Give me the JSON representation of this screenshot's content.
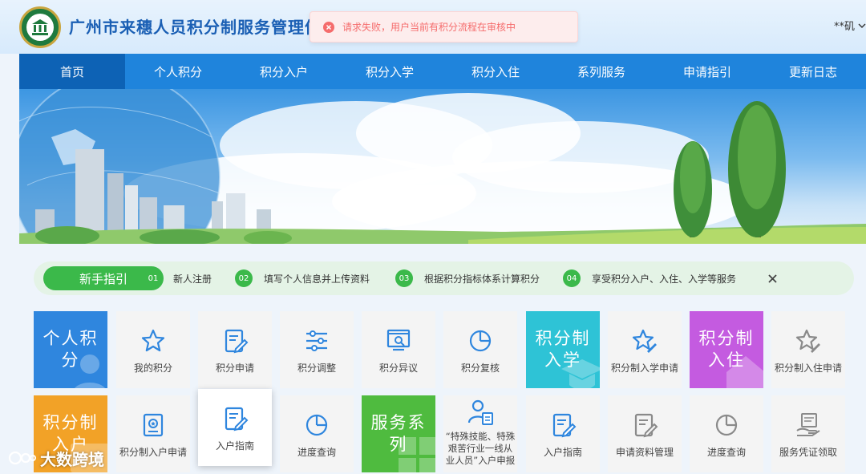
{
  "header": {
    "site_title": "广州市来穗人员积分制服务管理信息系统",
    "user_name": "**矶"
  },
  "toast": {
    "message": "请求失败，用户当前有积分流程在审核中"
  },
  "nav": {
    "items": [
      {
        "label": "首页"
      },
      {
        "label": "个人积分"
      },
      {
        "label": "积分入户"
      },
      {
        "label": "积分入学"
      },
      {
        "label": "积分入住"
      },
      {
        "label": "系列服务"
      },
      {
        "label": "申请指引"
      },
      {
        "label": "更新日志"
      }
    ]
  },
  "guide": {
    "tag": "新手指引",
    "steps": [
      {
        "num": "01",
        "text": "新人注册"
      },
      {
        "num": "02",
        "text": "填写个人信息并上传资料"
      },
      {
        "num": "03",
        "text": "根据积分指标体系计算积分"
      },
      {
        "num": "04",
        "text": "享受积分入户、入住、入学等服务"
      }
    ]
  },
  "row1": {
    "cat_personal": "个人积分",
    "my_points": "我的积分",
    "points_apply": "积分申请",
    "points_adjust": "积分调整",
    "points_dispute": "积分异议",
    "points_review": "积分复核",
    "cat_school": "积分制入学",
    "school_apply": "积分制入学申请",
    "cat_housing": "积分制入住",
    "housing_apply": "积分制入住申请"
  },
  "row2": {
    "cat_hukou": "积分制入户",
    "hukou_apply": "积分制入户申请",
    "hukou_guide": "入户指南",
    "progress_query": "进度查询",
    "cat_service": "服务系列",
    "special_workers": "“特殊技能、特殊艰苦行业一线从业人员”入户申报",
    "entry_guide": "入户指南",
    "materials_manage": "申请资料管理",
    "progress_query2": "进度查询",
    "certificate_pickup": "服务凭证领取"
  },
  "watermark": {
    "text": "大数跨境"
  },
  "colors": {
    "nav_bg": "#1f84dc",
    "nav_active": "#0d62b5",
    "title_blue": "#1a5fb4",
    "guide_green": "#3bb94a",
    "cat_blue": "#2f86de",
    "cat_cyan": "#2ec3d6",
    "cat_purple": "#c45be0",
    "cat_orange": "#f2a227",
    "cat_green": "#4fbb3f",
    "icon_blue": "#2f86de",
    "icon_gray": "#8a8a8a",
    "toast_red": "#f56c6c"
  }
}
